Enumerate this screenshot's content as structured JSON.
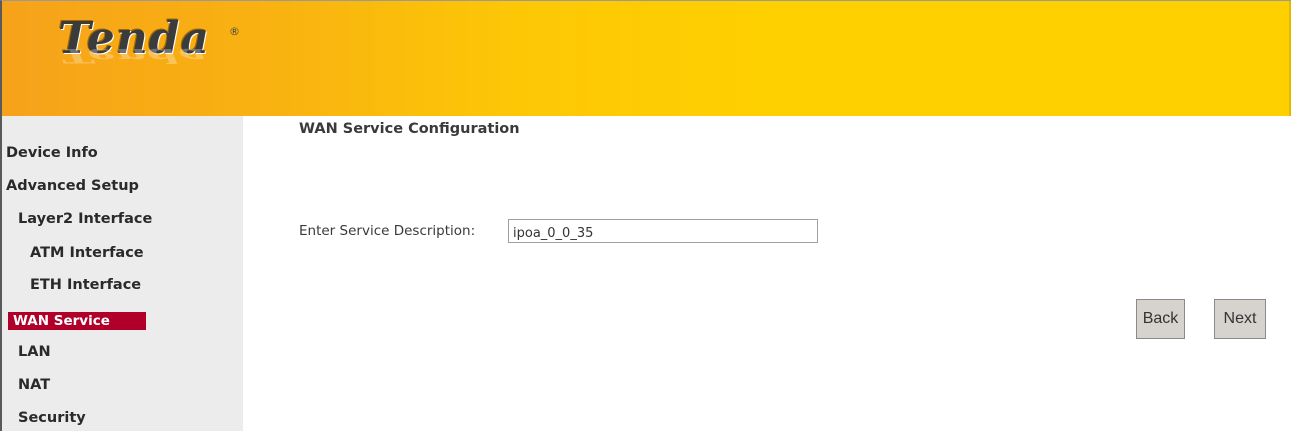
{
  "brand": {
    "logo_text": "Tenda",
    "registered_mark": "®"
  },
  "sidebar": {
    "items": [
      {
        "label": "Device Info"
      },
      {
        "label": "Advanced Setup"
      },
      {
        "label": "Layer2 Interface"
      },
      {
        "label": "ATM Interface"
      },
      {
        "label": "ETH Interface"
      },
      {
        "label": "WAN Service",
        "active": true
      },
      {
        "label": "LAN"
      },
      {
        "label": "NAT"
      },
      {
        "label": "Security"
      }
    ]
  },
  "main": {
    "title": "WAN Service Configuration",
    "service_description": {
      "label": "Enter Service Description:",
      "value": "ipoa_0_0_35"
    }
  },
  "buttons": {
    "back": "Back",
    "next": "Next"
  },
  "colors": {
    "header_start": "#f6a21a",
    "header_end": "#ffd000",
    "sidebar_bg": "#ececec",
    "active_item_bg": "#b0002a"
  }
}
